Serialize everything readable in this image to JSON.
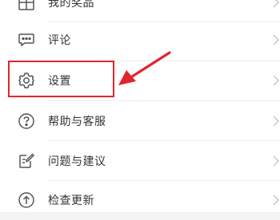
{
  "menu": {
    "items": [
      {
        "label": "我的奖品",
        "icon": "gift-icon"
      },
      {
        "label": "评论",
        "icon": "comment-bubble-icon"
      },
      {
        "label": "设置",
        "icon": "gear-icon"
      },
      {
        "label": "帮助与客服",
        "icon": "question-circle-icon"
      },
      {
        "label": "问题与建议",
        "icon": "feedback-edit-icon"
      },
      {
        "label": "检查更新",
        "icon": "arrow-up-circle-icon"
      }
    ]
  },
  "annotation": {
    "highlight_color": "#e0262c",
    "target": "设置"
  }
}
